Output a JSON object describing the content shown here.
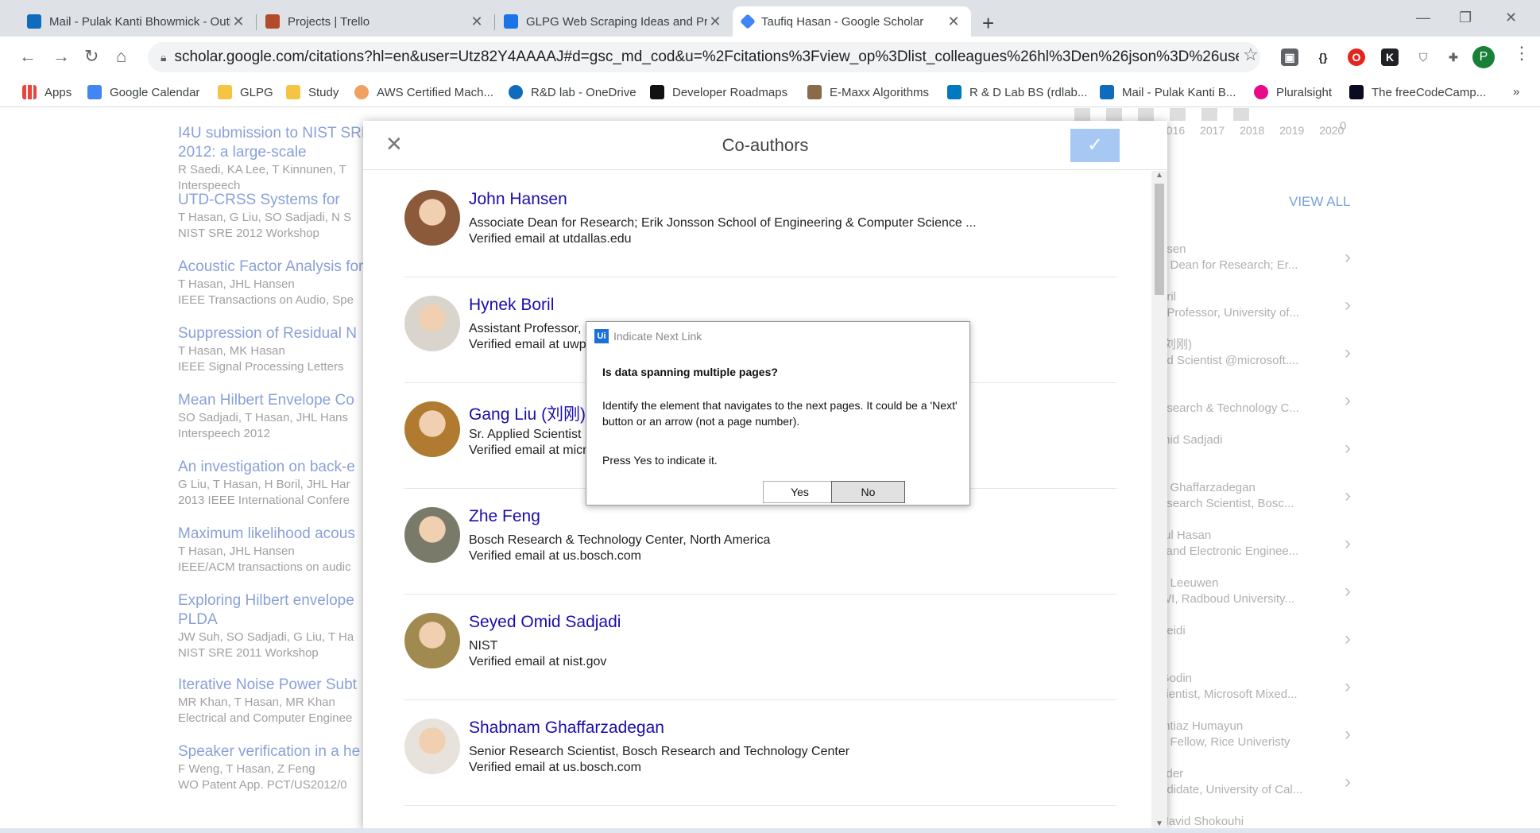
{
  "browser": {
    "tabs": [
      {
        "title": "Mail - Pulak Kanti Bhowmick - Outlook",
        "icon": "outlook-icon",
        "color": "#0f6cbd"
      },
      {
        "title": "Projects | Trello",
        "icon": "trello-icon",
        "color": "#b34a2c"
      },
      {
        "title": "GLPG Web Scraping Ideas and Process",
        "icon": "docs-icon",
        "color": "#1a73e8"
      },
      {
        "title": "Taufiq Hasan - Google Scholar",
        "icon": "scholar-icon",
        "color": "#4285f4"
      }
    ],
    "url": "scholar.google.com/citations?hl=en&user=Utz82Y4AAAAJ#d=gsc_md_cod&u=%2Fcitations%3Fview_op%3Dlist_colleagues%26hl%3Den%26json%3D%26user%3DUtz82...",
    "profile_initial": "P",
    "bookmarks": [
      "Apps",
      "Google Calendar",
      "GLPG",
      "Study",
      "AWS Certified Mach...",
      "R&D lab - OneDrive",
      "Developer Roadmaps",
      "E-Maxx Algorithms",
      "R & D Lab BS (rdlab...",
      "Mail - Pulak Kanti B...",
      "Pluralsight",
      "The freeCodeCamp..."
    ],
    "overflow": "»"
  },
  "background": {
    "publications": [
      {
        "title": "I4U submission to NIST SRE 2012: a large-scale collaborative effort for noise-robust speaker verification",
        "authors": "R Saedi, KA Lee, T Kinnunen, T",
        "venue": "Interspeech"
      },
      {
        "title": "UTD-CRSS Systems for 2012 NIST",
        "authors": "T Hasan, G Liu, SO Sadjadi, N S",
        "venue": "NIST SRE 2012 Workshop"
      },
      {
        "title": "Acoustic Factor Analysis for",
        "authors": "T Hasan, JHL Hansen",
        "venue": "IEEE Transactions on Audio, Spe"
      },
      {
        "title": "Suppression of Residual N",
        "authors": "T Hasan, MK Hasan",
        "venue": "IEEE Signal Processing Letters"
      },
      {
        "title": "Mean Hilbert Envelope Co",
        "authors": "SO Sadjadi, T Hasan, JHL Hans",
        "venue": "Interspeech 2012"
      },
      {
        "title": "An investigation on back-e",
        "authors": "G Liu, T Hasan, H Boril, JHL Har",
        "venue": "2013 IEEE International Confere"
      },
      {
        "title": "Maximum likelihood acous",
        "authors": "T Hasan, JHL Hansen",
        "venue": "IEEE/ACM transactions on audic"
      },
      {
        "title": "Exploring Hilbert envelope PLDA",
        "authors": "JW Suh, SO Sadjadi, G Liu, T Ha",
        "venue": "NIST SRE 2011 Workshop"
      },
      {
        "title": "Iterative Noise Power Subt",
        "authors": "MR Khan, T Hasan, MR Khan",
        "venue": "Electrical and Computer Enginee"
      },
      {
        "title": "Speaker verification in a he",
        "authors": "F Weng, T Hasan, Z Feng",
        "venue": "WO Patent App. PCT/US2012/0"
      }
    ],
    "years": [
      "2016",
      "2017",
      "2018",
      "2019",
      "2020"
    ],
    "zero": "0",
    "view_all": "VIEW ALL",
    "coauthor_side": [
      {
        "n": "nsen",
        "d": "e Dean for Research; Er..."
      },
      {
        "n": "oril",
        "d": "t Professor, University of..."
      },
      {
        "n": "(刘刚)",
        "d": "ed Scientist @microsoft...."
      },
      {
        "n": "g",
        "d": "esearch & Technology C..."
      },
      {
        "n": "mid Sadjadi",
        "d": ""
      },
      {
        "n": "n Ghaffarzadegan",
        "d": "esearch Scientist, Bosc..."
      },
      {
        "n": "rul Hasan",
        "d": "l and Electronic Enginee..."
      },
      {
        "n": "n Leeuwen",
        "d": "WI, Radboud University..."
      },
      {
        "n": "aeidi",
        "d": ""
      },
      {
        "n": "Godin",
        "d": "cientist, Microsoft Mixed..."
      },
      {
        "n": "mtiaz Humayun",
        "d": "e Fellow, Rice Univeristy"
      },
      {
        "n": "yder",
        "d": "ndidate, University of Cal..."
      },
      {
        "n": "Navid Shokouhi",
        "d": ""
      }
    ]
  },
  "coauthors_dialog": {
    "title": "Co-authors",
    "close": "✕",
    "confirm": "✓",
    "items": [
      {
        "name": "John Hansen",
        "affiliation": "Associate Dean for Research; Erik Jonsson School of Engineering & Computer Science ...",
        "email": "Verified email at utdallas.edu"
      },
      {
        "name": "Hynek Boril",
        "affiliation": "Assistant Professor, University of Wisconsin",
        "email": "Verified email at uwplatt.edu"
      },
      {
        "name": "Gang Liu (刘刚)",
        "affiliation": "Sr. Applied Scientist @microsoft.com",
        "email": "Verified email at microsoft.com"
      },
      {
        "name": "Zhe Feng",
        "affiliation": "Bosch Research & Technology Center, North America",
        "email": "Verified email at us.bosch.com"
      },
      {
        "name": "Seyed Omid Sadjadi",
        "affiliation": "NIST",
        "email": "Verified email at nist.gov"
      },
      {
        "name": "Shabnam Ghaffarzadegan",
        "affiliation": "Senior Research Scientist, Bosch Research and Technology Center",
        "email": "Verified email at us.bosch.com"
      }
    ]
  },
  "uipath_dialog": {
    "logo": "Ui",
    "title": "Indicate Next Link",
    "question": "Is data spanning multiple pages?",
    "description": "Identify the element that navigates to the next pages. It could be a 'Next' button or an arrow (not a page number).",
    "instruction": "Press Yes to indicate it.",
    "yes": "Yes",
    "no": "No"
  }
}
